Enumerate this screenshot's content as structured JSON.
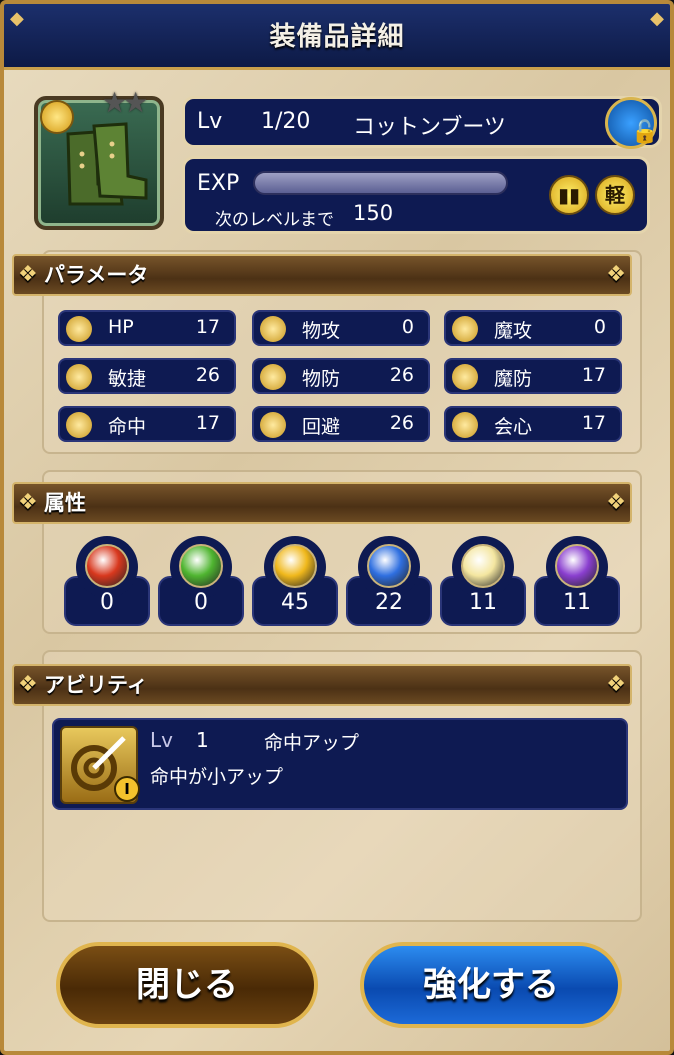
{
  "header": {
    "title": "装備品詳細"
  },
  "item": {
    "level_label": "Lv",
    "level": "1/20",
    "name": "コットンブーツ",
    "exp_label": "EXP",
    "next_level_label": "次のレベルまで",
    "next_level_exp": "150",
    "exp_progress": 0,
    "weight_badge": "軽",
    "stars_total": 2,
    "lock_icon": "lock-icon"
  },
  "parameters": {
    "heading": "パラメータ",
    "stats": [
      {
        "name": "HP",
        "value": "17",
        "icon": "heart-icon"
      },
      {
        "name": "物攻",
        "value": "0",
        "icon": "sword-icon"
      },
      {
        "name": "魔攻",
        "value": "0",
        "icon": "staff-icon"
      },
      {
        "name": "敏捷",
        "value": "26",
        "icon": "wing-boot-icon"
      },
      {
        "name": "物防",
        "value": "26",
        "icon": "shield-icon"
      },
      {
        "name": "魔防",
        "value": "17",
        "icon": "magic-shield-icon"
      },
      {
        "name": "命中",
        "value": "17",
        "icon": "target-icon"
      },
      {
        "name": "回避",
        "value": "26",
        "icon": "dodge-icon"
      },
      {
        "name": "会心",
        "value": "17",
        "icon": "fist-icon"
      }
    ]
  },
  "attributes": {
    "heading": "属性",
    "elements": [
      {
        "icon": "fire-orb-icon",
        "value": "0",
        "color": "#d8381e"
      },
      {
        "icon": "wind-orb-icon",
        "value": "0",
        "color": "#4fb530"
      },
      {
        "icon": "thunder-orb-icon",
        "value": "45",
        "color": "#f0b81c"
      },
      {
        "icon": "ice-orb-icon",
        "value": "22",
        "color": "#2f6fe0"
      },
      {
        "icon": "light-orb-icon",
        "value": "11",
        "color": "#f4e6a0"
      },
      {
        "icon": "dark-orb-icon",
        "value": "11",
        "color": "#8a3fcf"
      }
    ]
  },
  "ability": {
    "heading": "アビリティ",
    "level_label": "Lv",
    "level": "1",
    "name": "命中アップ",
    "description": "命中が小アップ",
    "badge": "I"
  },
  "buttons": {
    "close": "閉じる",
    "upgrade": "強化する"
  }
}
